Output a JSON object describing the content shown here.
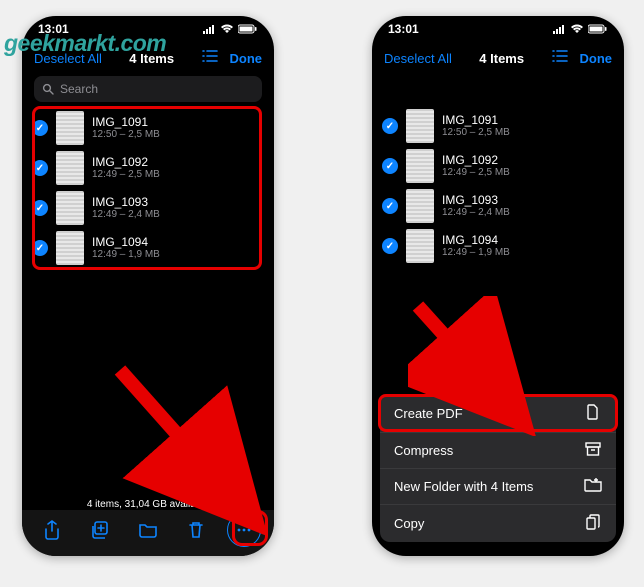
{
  "watermark": "geekmarkt.com",
  "status": {
    "time": "13:01"
  },
  "nav": {
    "deselect": "Deselect All",
    "title": "4 Items",
    "done": "Done"
  },
  "search": {
    "placeholder": "Search"
  },
  "files": [
    {
      "name": "IMG_1091",
      "sub": "12:50 – 2,5 MB"
    },
    {
      "name": "IMG_1092",
      "sub": "12:49 – 2,5 MB"
    },
    {
      "name": "IMG_1093",
      "sub": "12:49 – 2,4 MB"
    },
    {
      "name": "IMG_1094",
      "sub": "12:49 – 1,9 MB"
    }
  ],
  "bottom_status": "4 items, 31,04 GB available",
  "menu": {
    "create_pdf": "Create PDF",
    "compress": "Compress",
    "new_folder": "New Folder with 4 Items",
    "copy": "Copy"
  }
}
